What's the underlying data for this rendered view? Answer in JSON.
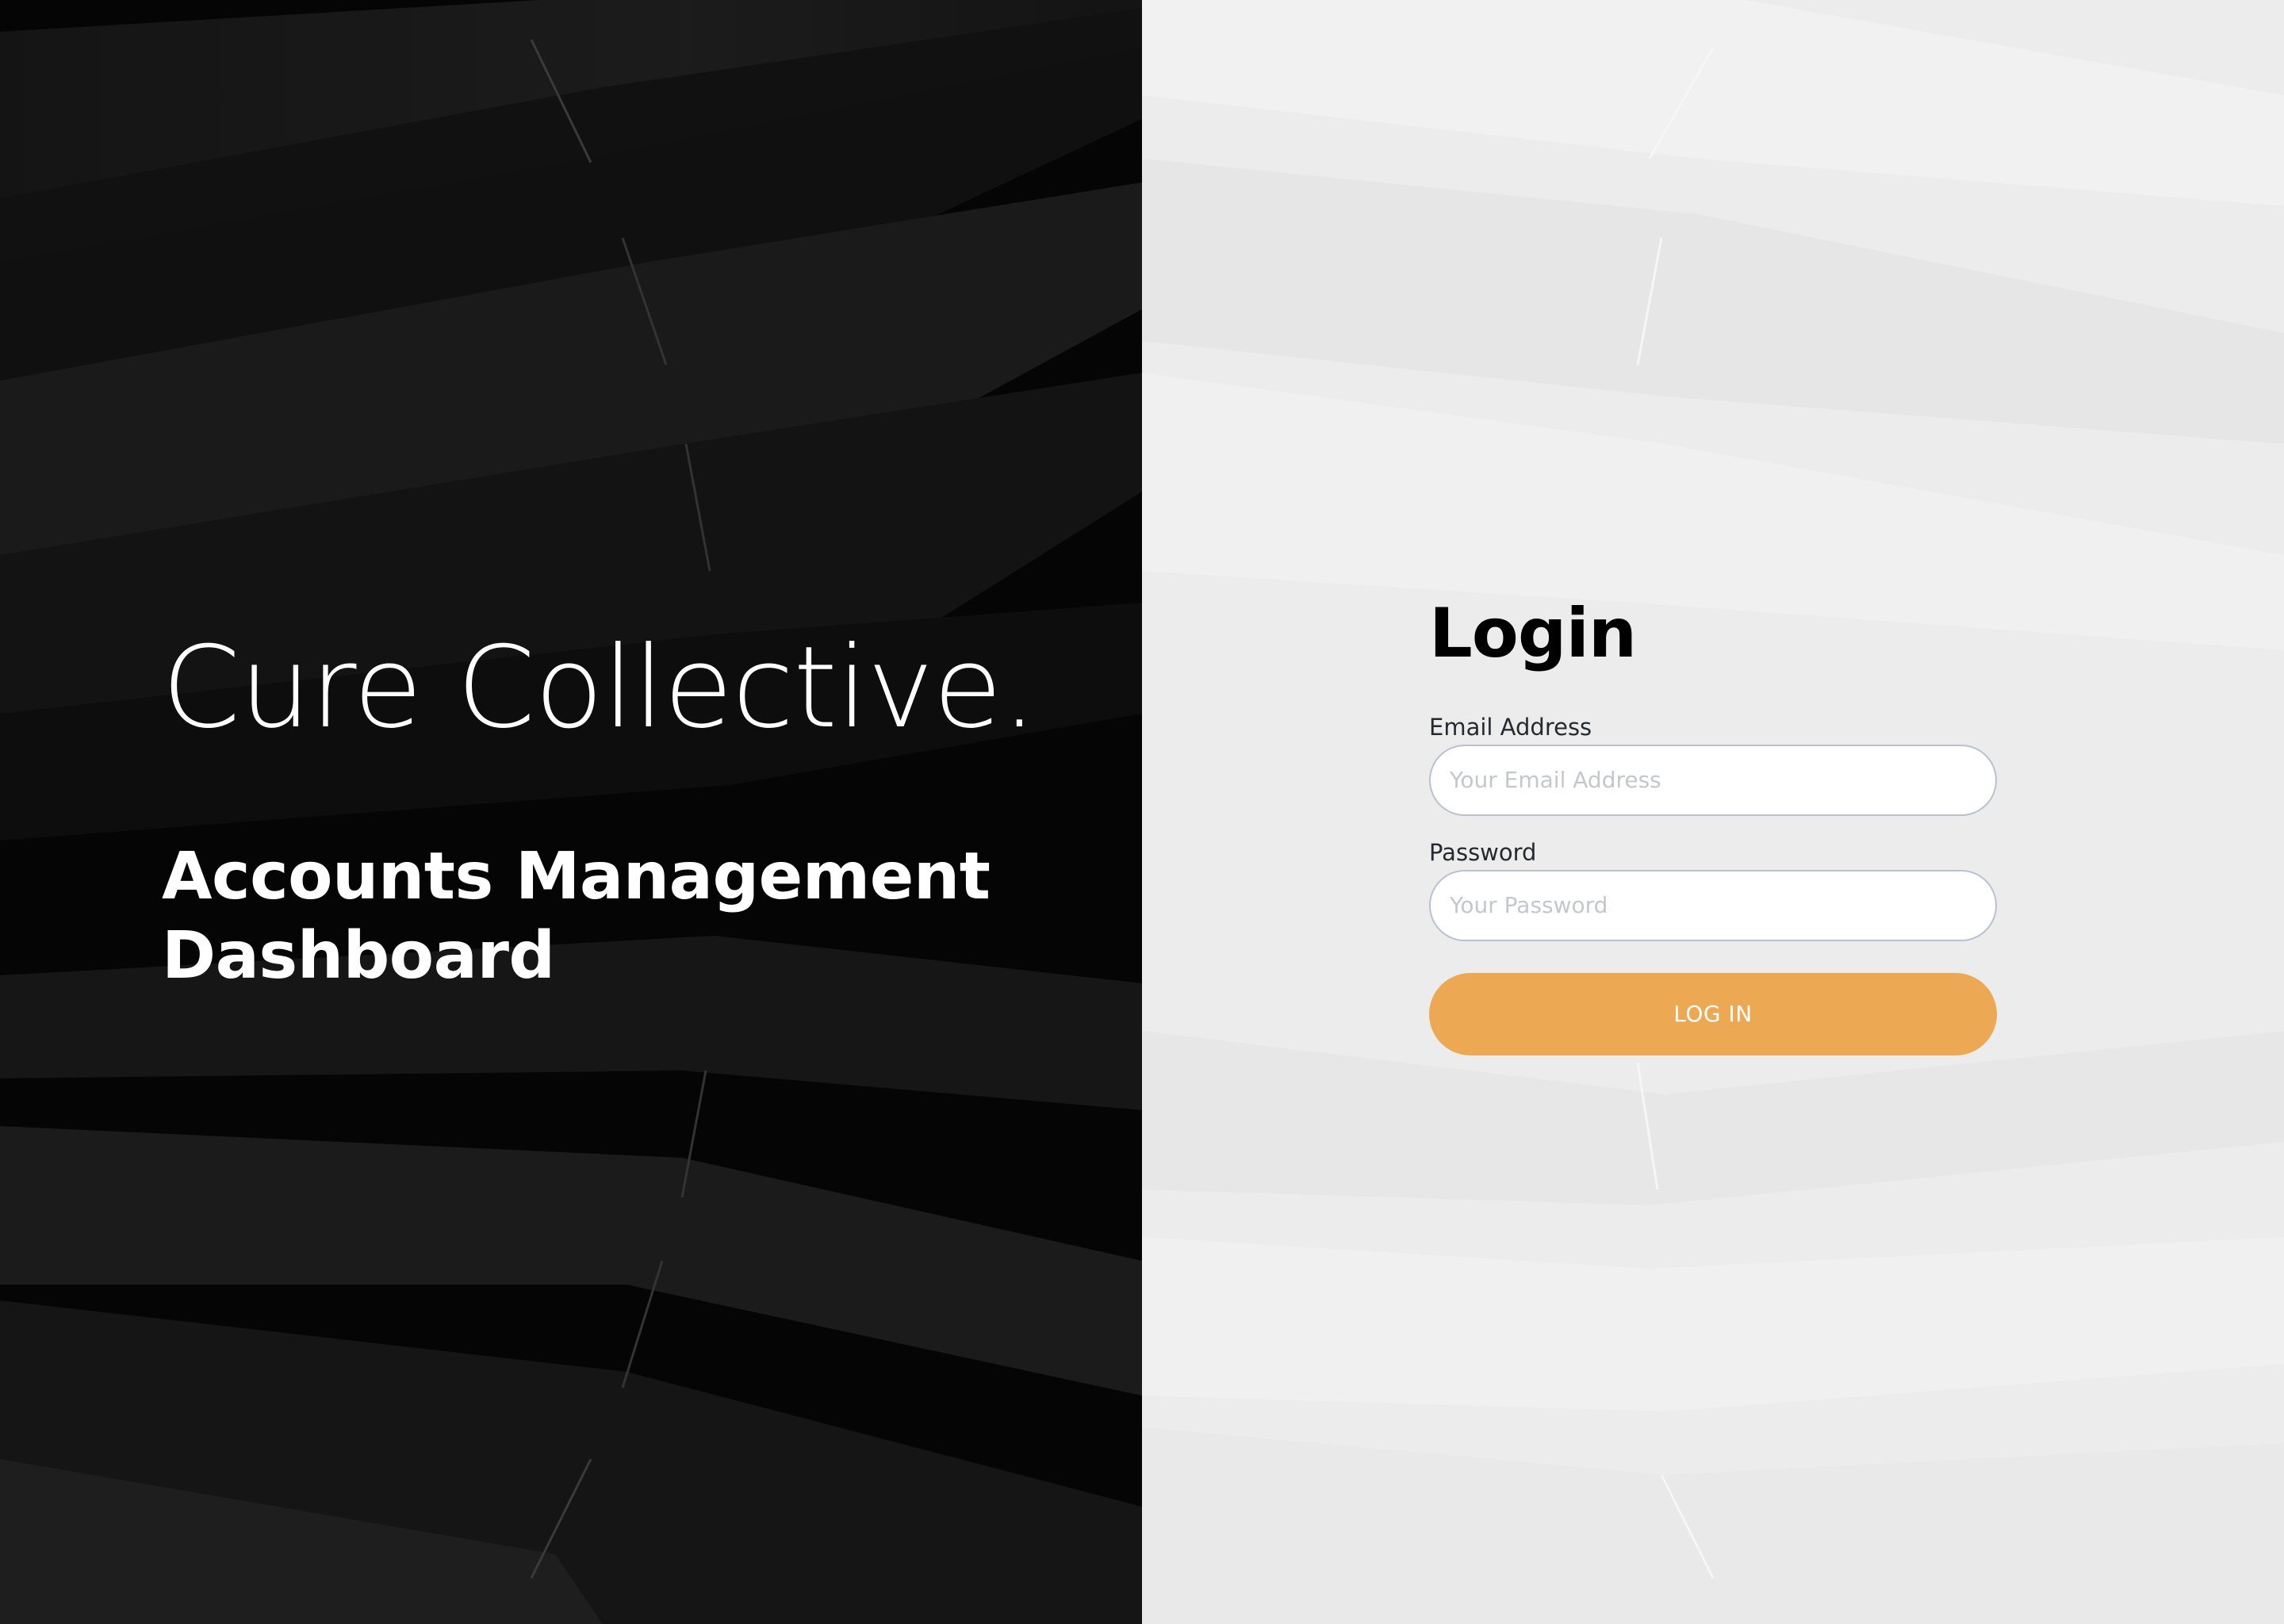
{
  "brand": {
    "name": "Cure Collective.",
    "subtitle": "Accounts Management Dashboard"
  },
  "login": {
    "title": "Login",
    "email": {
      "label": "Email Address",
      "placeholder": "Your Email Address",
      "value": ""
    },
    "password": {
      "label": "Password",
      "placeholder": "Your Password",
      "value": ""
    },
    "submit_label": "LOG IN"
  },
  "colors": {
    "left_panel_background": "#0b0b0b",
    "right_panel_background": "#ececec",
    "button_accent": "#eda853",
    "input_border": "#b8c3d1",
    "heading_text": "#000000",
    "brand_text": "#ffffff"
  }
}
